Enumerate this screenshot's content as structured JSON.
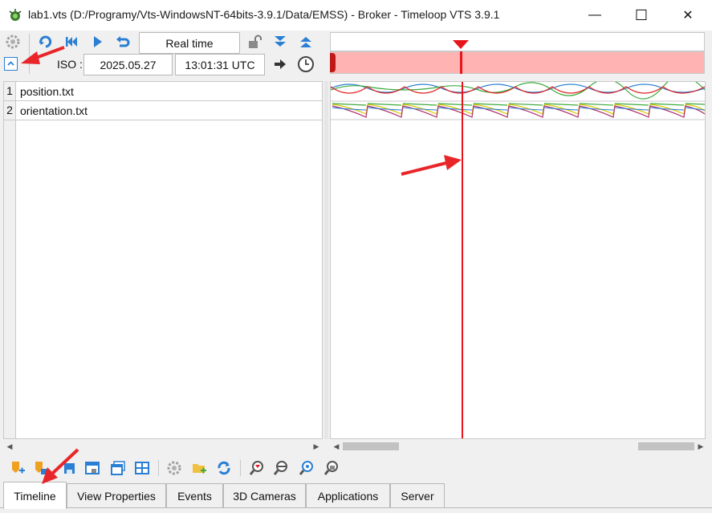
{
  "window": {
    "title": "lab1.vts (D:/Programy/Vts-WindowsNT-64bits-3.9.1/Data/EMSS) - Broker - Timeloop VTS 3.9.1",
    "minimize_glyph": "—",
    "maximize_glyph": "☐",
    "close_glyph": "✕"
  },
  "toolbar": {
    "mode_button_label": "Real time",
    "iso_label": "ISO :",
    "date_value": "2025.05.27",
    "time_value": "13:01:31 UTC"
  },
  "files": [
    {
      "index": "1",
      "name": "position.txt"
    },
    {
      "index": "2",
      "name": "orientation.txt"
    }
  ],
  "tabs": [
    {
      "label": "Timeline",
      "active": true
    },
    {
      "label": "View Properties",
      "active": false
    },
    {
      "label": "Events",
      "active": false
    },
    {
      "label": "3D Cameras",
      "active": false
    },
    {
      "label": "Applications",
      "active": false
    },
    {
      "label": "Server",
      "active": false
    }
  ],
  "colors": {
    "timeline_band": "#ffb3b3",
    "cursor": "#e8141c",
    "accent_blue": "#2a7fd4",
    "annotation_arrow": "#e8262a"
  },
  "icons": [
    "settings-icon",
    "collapse-icon",
    "loop-icon",
    "skip-start-icon",
    "play-icon",
    "undo-icon",
    "lock-icon",
    "down-icon",
    "up-icon",
    "arrow-right-icon",
    "clock-icon"
  ]
}
